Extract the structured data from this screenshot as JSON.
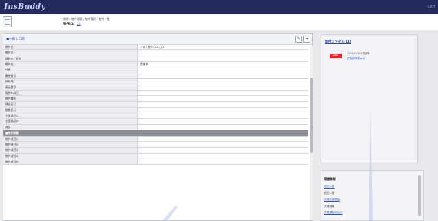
{
  "app": {
    "logo": "InsBuddy",
    "top_right": "ヘルプ"
  },
  "header": {
    "breadcrumb": "物件・物件管理 / 物件管理 / 物件一覧",
    "record_id_label": "物件ID:",
    "record_id_value": "13"
  },
  "panel": {
    "title": "■一般 | 二期",
    "edit_icon": "pencil-icon",
    "export_icon": "export-icon"
  },
  "fields": [
    {
      "label": "物件名",
      "value": "テスト物件0004_23"
    },
    {
      "label": "物件名",
      "value": ""
    },
    {
      "label": "建物名／室名",
      "value": ""
    },
    {
      "label": "物件名",
      "value": "賃貸中"
    },
    {
      "label": "住所",
      "value": ""
    },
    {
      "label": "郵便番号",
      "value": ""
    },
    {
      "label": "所在地",
      "value": ""
    },
    {
      "label": "電話番号",
      "value": ""
    },
    {
      "label": "契約年月日",
      "value": ""
    },
    {
      "label": "物件種別",
      "value": ""
    },
    {
      "label": "構造区分",
      "value": ""
    },
    {
      "label": "階数区分",
      "value": ""
    },
    {
      "label": "主要部品１",
      "value": ""
    },
    {
      "label": "主要部品２",
      "value": ""
    },
    {
      "label": "合計",
      "value": ""
    },
    {
      "label": "■物件情報",
      "value": "",
      "section": true
    },
    {
      "label": "物件項目１",
      "value": ""
    },
    {
      "label": "物件項目２",
      "value": ""
    },
    {
      "label": "物件項目３",
      "value": ""
    },
    {
      "label": "物件項目４",
      "value": ""
    },
    {
      "label": "物件項目５",
      "value": ""
    }
  ],
  "attachments": {
    "title": "添付ファイル (1)",
    "items": [
      {
        "badge": "PDF",
        "date": "2022/03/16 作成者等",
        "link": "資料説明書.pdf"
      }
    ]
  },
  "related": {
    "title": "関連情報",
    "items": [
      {
        "label": "部品一覧",
        "link": true
      },
      {
        "label": "部品一覧",
        "link": false
      },
      {
        "label": "点検記録履歴",
        "link": true
      },
      {
        "label": "点検結果",
        "link": false
      },
      {
        "label": "点検履歴の出力",
        "link": true
      }
    ]
  },
  "colors": {
    "topbar": "#242a5c",
    "link": "#2a55c2",
    "pdf_badge": "#e3242b",
    "section_row": "#8c8c94"
  }
}
